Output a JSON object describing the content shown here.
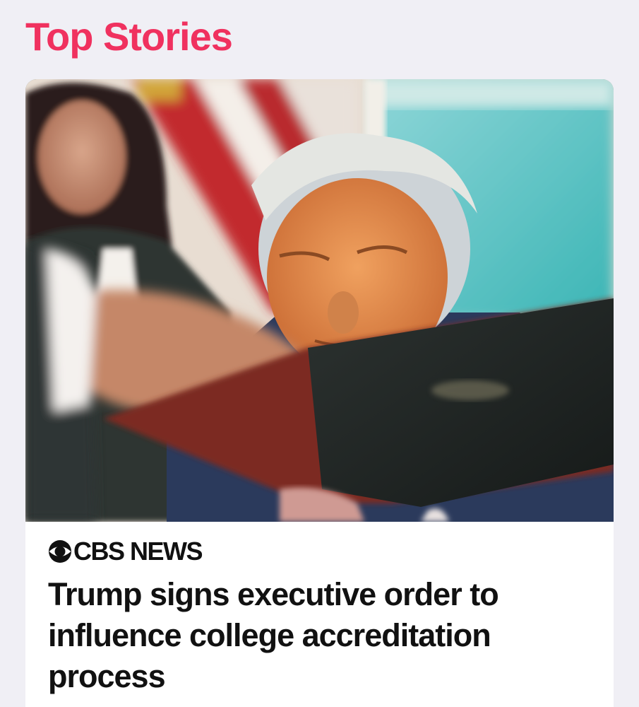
{
  "section": {
    "title": "Top Stories"
  },
  "story": {
    "source": "CBS NEWS",
    "headline": "Trump signs executive order to influence college accreditation process",
    "image_description_icon": "photo-icon"
  },
  "colors": {
    "accent": "#f0315f",
    "background": "#f0eff5",
    "card": "#ffffff",
    "text": "#111111"
  }
}
